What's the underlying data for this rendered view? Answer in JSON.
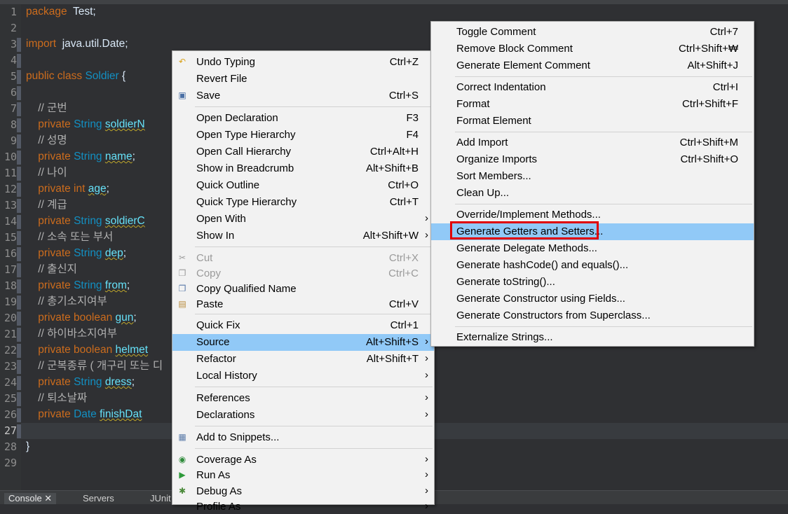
{
  "editor": {
    "lines": [
      {
        "n": "1",
        "parts": [
          [
            "kw",
            "package"
          ],
          [
            "",
            "  Test;"
          ]
        ]
      },
      {
        "n": "2",
        "parts": []
      },
      {
        "n": "3",
        "parts": [
          [
            "kw",
            "import"
          ],
          [
            "",
            "  java.util.Date;"
          ]
        ]
      },
      {
        "n": "4",
        "parts": []
      },
      {
        "n": "5",
        "parts": [
          [
            "kw",
            "public class"
          ],
          [
            "",
            " "
          ],
          [
            "cls",
            "Soldier"
          ],
          [
            "",
            " {"
          ]
        ]
      },
      {
        "n": "6",
        "parts": []
      },
      {
        "n": "7",
        "parts": [
          [
            "cmt",
            "    // 군번"
          ]
        ]
      },
      {
        "n": "8",
        "parts": [
          [
            "kw",
            "    private"
          ],
          [
            "",
            " "
          ],
          [
            "ty",
            "String"
          ],
          [
            "",
            " "
          ],
          [
            "fld",
            "soldierN"
          ]
        ]
      },
      {
        "n": "9",
        "parts": [
          [
            "cmt",
            "    // 성명"
          ]
        ]
      },
      {
        "n": "10",
        "parts": [
          [
            "kw",
            "    private"
          ],
          [
            "",
            " "
          ],
          [
            "ty",
            "String"
          ],
          [
            "",
            " "
          ],
          [
            "fld",
            "name"
          ],
          [
            "",
            ";"
          ]
        ]
      },
      {
        "n": "11",
        "parts": [
          [
            "cmt",
            "    // 나이"
          ]
        ]
      },
      {
        "n": "12",
        "parts": [
          [
            "kw",
            "    private int"
          ],
          [
            "",
            " "
          ],
          [
            "fld",
            "age"
          ],
          [
            "",
            ";"
          ]
        ]
      },
      {
        "n": "13",
        "parts": [
          [
            "cmt",
            "    // 계급"
          ]
        ]
      },
      {
        "n": "14",
        "parts": [
          [
            "kw",
            "    private"
          ],
          [
            "",
            " "
          ],
          [
            "ty",
            "String"
          ],
          [
            "",
            " "
          ],
          [
            "fld",
            "soldierC"
          ]
        ]
      },
      {
        "n": "15",
        "parts": [
          [
            "cmt",
            "    // 소속 또는 부서"
          ]
        ]
      },
      {
        "n": "16",
        "parts": [
          [
            "kw",
            "    private"
          ],
          [
            "",
            " "
          ],
          [
            "ty",
            "String"
          ],
          [
            "",
            " "
          ],
          [
            "fld",
            "dep"
          ],
          [
            "",
            ";"
          ]
        ]
      },
      {
        "n": "17",
        "parts": [
          [
            "cmt",
            "    // 출신지"
          ]
        ]
      },
      {
        "n": "18",
        "parts": [
          [
            "kw",
            "    private"
          ],
          [
            "",
            " "
          ],
          [
            "ty",
            "String"
          ],
          [
            "",
            " "
          ],
          [
            "fld",
            "from"
          ],
          [
            "",
            ";"
          ]
        ]
      },
      {
        "n": "19",
        "parts": [
          [
            "cmt",
            "    // 총기소지여부"
          ]
        ]
      },
      {
        "n": "20",
        "parts": [
          [
            "kw",
            "    private boolean"
          ],
          [
            "",
            " "
          ],
          [
            "fld",
            "gun"
          ],
          [
            "",
            ";"
          ]
        ]
      },
      {
        "n": "21",
        "parts": [
          [
            "cmt",
            "    // 하이바소지여부"
          ]
        ]
      },
      {
        "n": "22",
        "parts": [
          [
            "kw",
            "    private boolean"
          ],
          [
            "",
            " "
          ],
          [
            "fld",
            "helmet"
          ]
        ]
      },
      {
        "n": "23",
        "parts": [
          [
            "cmt",
            "    // 군복종류 ( 개구리 또는 디"
          ]
        ]
      },
      {
        "n": "24",
        "parts": [
          [
            "kw",
            "    private"
          ],
          [
            "",
            " "
          ],
          [
            "ty",
            "String"
          ],
          [
            "",
            " "
          ],
          [
            "fld",
            "dress"
          ],
          [
            "",
            ";"
          ]
        ]
      },
      {
        "n": "25",
        "parts": [
          [
            "cmt",
            "    // 퇴소날짜"
          ]
        ]
      },
      {
        "n": "26",
        "parts": [
          [
            "kw",
            "    private"
          ],
          [
            "",
            " "
          ],
          [
            "ty",
            "Date"
          ],
          [
            "",
            " "
          ],
          [
            "fld",
            "finishDat"
          ]
        ]
      },
      {
        "n": "27",
        "parts": []
      },
      {
        "n": "28",
        "parts": [
          [
            "",
            "}"
          ]
        ]
      },
      {
        "n": "29",
        "parts": []
      }
    ]
  },
  "bottom_tabs": {
    "console": "Console ✕",
    "servers": "Servers",
    "junit": "JUnit"
  },
  "context_menu": {
    "items": [
      {
        "label": "Undo Typing",
        "shortcut": "Ctrl+Z",
        "icon": "undo-icon",
        "glyph": "↶"
      },
      {
        "label": "Revert File",
        "shortcut": ""
      },
      {
        "label": "Save",
        "shortcut": "Ctrl+S",
        "icon": "save-icon",
        "glyph": "▣"
      },
      {
        "sep": true
      },
      {
        "label": "Open Declaration",
        "shortcut": "F3"
      },
      {
        "label": "Open Type Hierarchy",
        "shortcut": "F4"
      },
      {
        "label": "Open Call Hierarchy",
        "shortcut": "Ctrl+Alt+H"
      },
      {
        "label": "Show in Breadcrumb",
        "shortcut": "Alt+Shift+B"
      },
      {
        "label": "Quick Outline",
        "shortcut": "Ctrl+O"
      },
      {
        "label": "Quick Type Hierarchy",
        "shortcut": "Ctrl+T"
      },
      {
        "label": "Open With",
        "shortcut": "",
        "submenu": true
      },
      {
        "label": "Show In",
        "shortcut": "Alt+Shift+W",
        "submenu": true
      },
      {
        "sep": true
      },
      {
        "label": "Cut",
        "shortcut": "Ctrl+X",
        "disabled": true,
        "icon": "cut-icon",
        "glyph": "✂"
      },
      {
        "label": "Copy",
        "shortcut": "Ctrl+C",
        "disabled": true,
        "icon": "copy-icon",
        "glyph": "❐"
      },
      {
        "label": "Copy Qualified Name",
        "shortcut": "",
        "icon": "copy-qualified-name-icon",
        "glyph": "❐"
      },
      {
        "label": "Paste",
        "shortcut": "Ctrl+V",
        "icon": "paste-icon",
        "glyph": "▤"
      },
      {
        "sep": true
      },
      {
        "label": "Quick Fix",
        "shortcut": "Ctrl+1"
      },
      {
        "label": "Source",
        "shortcut": "Alt+Shift+S",
        "submenu": true,
        "highlighted": true
      },
      {
        "label": "Refactor",
        "shortcut": "Alt+Shift+T",
        "submenu": true
      },
      {
        "label": "Local History",
        "shortcut": "",
        "submenu": true
      },
      {
        "sep": true
      },
      {
        "label": "References",
        "shortcut": "",
        "submenu": true
      },
      {
        "label": "Declarations",
        "shortcut": "",
        "submenu": true
      },
      {
        "sep": true
      },
      {
        "label": "Add to Snippets...",
        "shortcut": "",
        "icon": "snippet-icon",
        "glyph": "▦"
      },
      {
        "sep": true
      },
      {
        "label": "Coverage As",
        "shortcut": "",
        "submenu": true,
        "icon": "coverage-icon",
        "glyph": "◉"
      },
      {
        "label": "Run As",
        "shortcut": "",
        "submenu": true,
        "icon": "run-icon",
        "glyph": "▶"
      },
      {
        "label": "Debug As",
        "shortcut": "",
        "submenu": true,
        "icon": "debug-icon",
        "glyph": "✱"
      },
      {
        "label": "Profile As",
        "shortcut": "",
        "submenu": true
      }
    ]
  },
  "source_menu": {
    "items": [
      {
        "label": "Toggle Comment",
        "shortcut": "Ctrl+7"
      },
      {
        "label": "Remove Block Comment",
        "shortcut": "Ctrl+Shift+₩"
      },
      {
        "label": "Generate Element Comment",
        "shortcut": "Alt+Shift+J"
      },
      {
        "sep": true
      },
      {
        "label": "Correct Indentation",
        "shortcut": "Ctrl+I"
      },
      {
        "label": "Format",
        "shortcut": "Ctrl+Shift+F"
      },
      {
        "label": "Format Element",
        "shortcut": ""
      },
      {
        "sep": true
      },
      {
        "label": "Add Import",
        "shortcut": "Ctrl+Shift+M"
      },
      {
        "label": "Organize Imports",
        "shortcut": "Ctrl+Shift+O"
      },
      {
        "label": "Sort Members...",
        "shortcut": ""
      },
      {
        "label": "Clean Up...",
        "shortcut": ""
      },
      {
        "sep": true
      },
      {
        "label": "Override/Implement Methods...",
        "shortcut": ""
      },
      {
        "label": "Generate Getters and Setters...",
        "shortcut": "",
        "highlighted": true
      },
      {
        "label": "Generate Delegate Methods...",
        "shortcut": ""
      },
      {
        "label": "Generate hashCode() and equals()...",
        "shortcut": ""
      },
      {
        "label": "Generate toString()...",
        "shortcut": ""
      },
      {
        "label": "Generate Constructor using Fields...",
        "shortcut": ""
      },
      {
        "label": "Generate Constructors from Superclass...",
        "shortcut": ""
      },
      {
        "sep": true
      },
      {
        "label": "Externalize Strings...",
        "shortcut": ""
      }
    ]
  },
  "colors": {
    "highlight": "#91c9f7",
    "callout_red": "#e00000"
  }
}
